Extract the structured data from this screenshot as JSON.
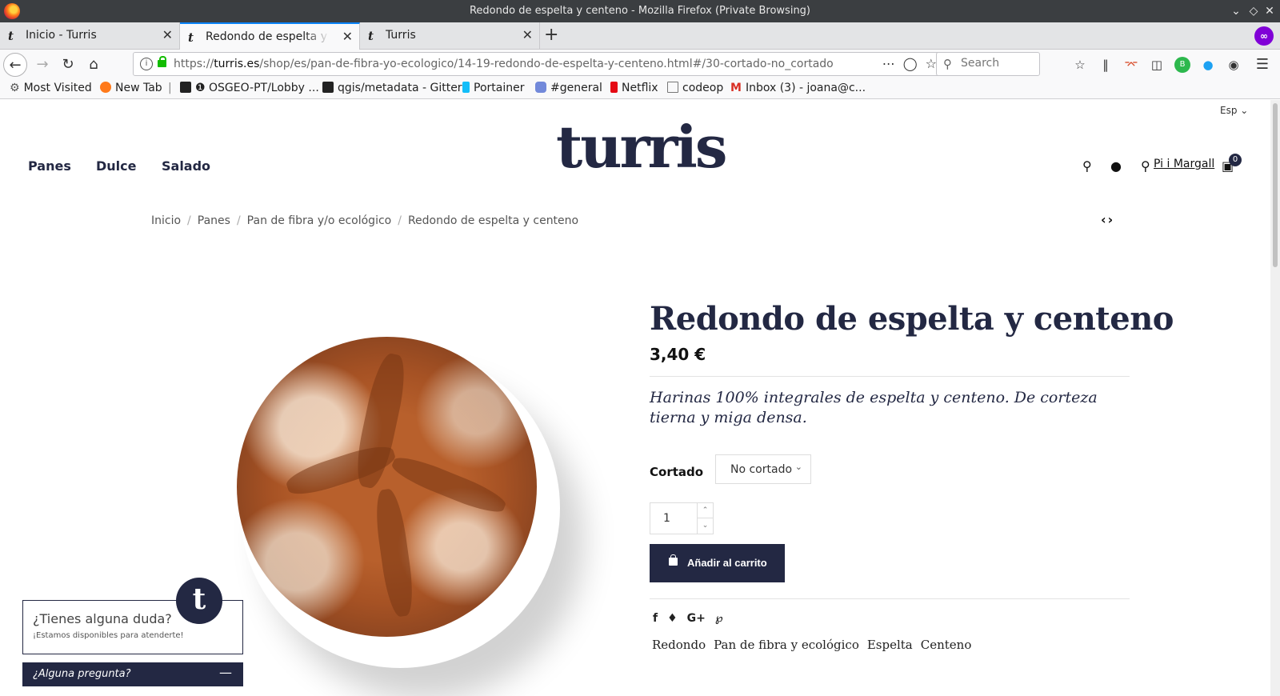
{
  "window": {
    "title": "Redondo de espelta y centeno - Mozilla Firefox (Private Browsing)"
  },
  "tabs": [
    {
      "label": "Inicio - Turris",
      "favicon": "t"
    },
    {
      "label": "Redondo de espelta y centeno",
      "favicon": "t"
    },
    {
      "label": "Turris",
      "favicon": "t"
    }
  ],
  "navbar": {
    "url_prefix": "https://",
    "url_domain": "turris.es",
    "url_path": "/shop/es/pan-de-fibra-yo-ecologico/14-19-redondo-de-espelta-y-centeno.html#/30-cortado-no_cortado",
    "search_placeholder": "Search"
  },
  "bookmarks": [
    {
      "label": "Most Visited",
      "icon": "gear-icon",
      "color": "#555555"
    },
    {
      "label": "New Tab",
      "icon": "firefox-icon",
      "color": "#ff7a1a"
    },
    {
      "label": "OSGEO-PT/Lobby ...",
      "icon": "gitter-icon",
      "color": "#222222"
    },
    {
      "label": "qgis/metadata - Gitter",
      "icon": "gitter-icon",
      "color": "#222222"
    },
    {
      "label": "Portainer",
      "icon": "portainer-icon",
      "color": "#13bef9"
    },
    {
      "label": "#general",
      "icon": "discord-icon",
      "color": "#7289da"
    },
    {
      "label": "Netflix",
      "icon": "netflix-icon",
      "color": "#e50914"
    },
    {
      "label": "codeop",
      "icon": "folder-icon",
      "color": "#888888"
    },
    {
      "label": "Inbox (3) - joana@c...",
      "icon": "gmail-icon",
      "color": "#d93025"
    }
  ],
  "site": {
    "language": "Esp",
    "logo": "turris",
    "nav": [
      "Panes",
      "Dulce",
      "Salado"
    ],
    "store": "Pi i Margall",
    "cart_count": "0",
    "brand_color": "#232843"
  },
  "breadcrumb": [
    "Inicio",
    "Panes",
    "Pan de fibra y/o ecológico",
    "Redondo de espelta y centeno"
  ],
  "product": {
    "title": "Redondo de espelta y centeno",
    "price": "3,40 €",
    "description": "Harinas 100% integrales de espelta y centeno. De corteza tierna y miga densa.",
    "option_label": "Cortado",
    "option_value": "No cortado",
    "quantity": "1",
    "add_to_cart": "Añadir al carrito",
    "tags": [
      "Redondo",
      "Pan de fibra y ecológico",
      "Espelta",
      "Centeno"
    ]
  },
  "chat": {
    "question": "¿Tienes alguna duda?",
    "subtitle": "¡Estamos disponibles para atenderte!",
    "bar_label": "¿Alguna pregunta?",
    "logo_letter": "t"
  }
}
